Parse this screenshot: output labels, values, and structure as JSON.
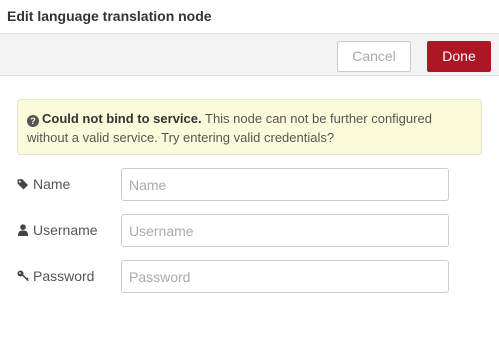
{
  "dialog": {
    "title": "Edit language translation node"
  },
  "buttons": {
    "cancel_label": "Cancel",
    "done_label": "Done"
  },
  "alert": {
    "icon": "question-circle-icon",
    "bold_text": "Could not bind to service.",
    "message": " This node can not be further configured without a valid service. Try entering valid credentials?"
  },
  "form": {
    "name": {
      "label": "Name",
      "placeholder": "Name",
      "value": "",
      "icon": "tag-icon"
    },
    "username": {
      "label": "Username",
      "placeholder": "Username",
      "value": "",
      "icon": "user-icon"
    },
    "password": {
      "label": "Password",
      "placeholder": "Password",
      "value": "",
      "icon": "key-icon"
    }
  },
  "colors": {
    "done_button": "#ad1625",
    "alert_background": "#fbfbdc",
    "button_bar_background": "#f3f3f3"
  }
}
